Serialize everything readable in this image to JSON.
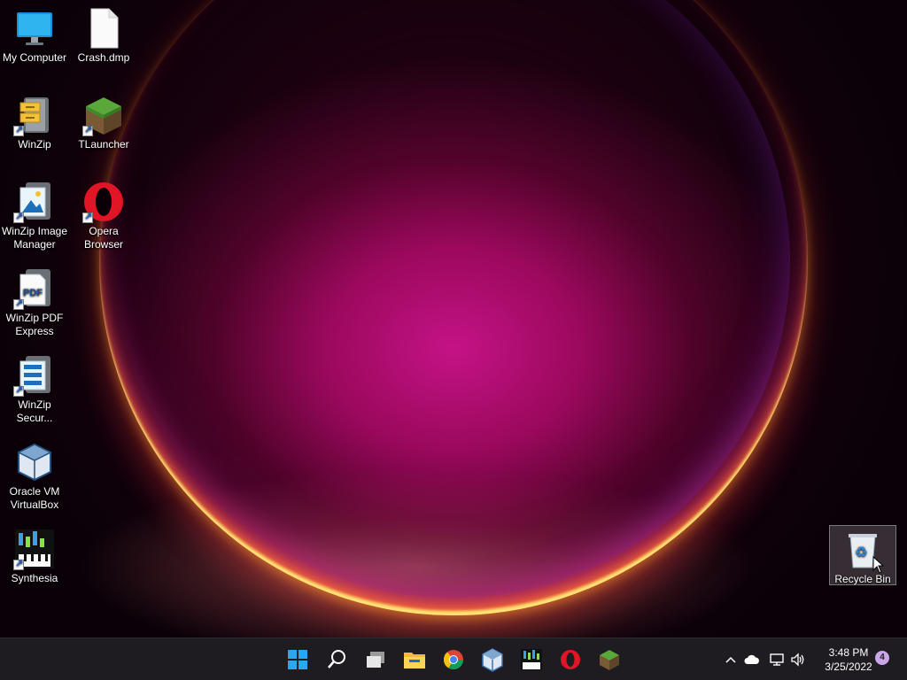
{
  "desktop": {
    "icons": [
      {
        "label": "My Computer"
      },
      {
        "label": "Crash.dmp"
      },
      {
        "label": "WinZip"
      },
      {
        "label": "TLauncher"
      },
      {
        "label": "WinZip Image Manager"
      },
      {
        "label": "Opera Browser"
      },
      {
        "label": "WinZip PDF Express"
      },
      {
        "label": "WinZip Secur..."
      },
      {
        "label": "Oracle VM VirtualBox"
      },
      {
        "label": "Synthesia"
      },
      {
        "label": "Recycle Bin"
      }
    ]
  },
  "taskbar": {
    "apps": [
      "start",
      "search",
      "task-view",
      "file-explorer",
      "chrome",
      "virtualbox",
      "synthesia",
      "opera",
      "tlauncher"
    ],
    "tray": {
      "time": "3:48 PM",
      "date": "3/25/2022",
      "notifications": "4"
    }
  },
  "colors": {
    "accent": "#0a84ff",
    "taskbar": "#1f1c21",
    "notification_badge": "#c8a6e8"
  }
}
